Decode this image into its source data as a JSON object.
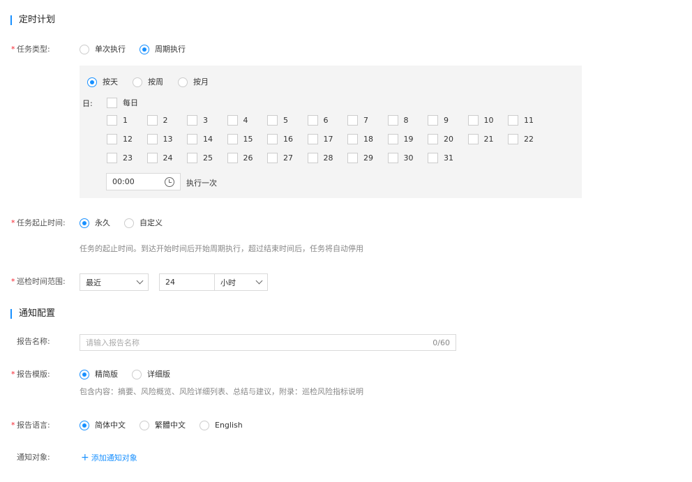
{
  "schedule": {
    "title": "定时计划",
    "task_type": {
      "label": "任务类型:",
      "options": [
        "单次执行",
        "周期执行"
      ],
      "selected": 1
    },
    "period": {
      "options": [
        "按天",
        "按周",
        "按月"
      ],
      "selected": 0,
      "day_label": "日:",
      "every_day": "每日",
      "days": [
        "1",
        "2",
        "3",
        "4",
        "5",
        "6",
        "7",
        "8",
        "9",
        "10",
        "11",
        "12",
        "13",
        "14",
        "15",
        "16",
        "17",
        "18",
        "19",
        "20",
        "21",
        "22",
        "23",
        "24",
        "25",
        "26",
        "27",
        "28",
        "29",
        "30",
        "31"
      ],
      "time": "00:00",
      "run_once": "执行一次"
    },
    "duration": {
      "label": "任务起止时间:",
      "options": [
        "永久",
        "自定义"
      ],
      "selected": 0,
      "hint": "任务的起止时间。到达开始时间后开始周期执行，超过结束时间后，任务将自动停用"
    },
    "range": {
      "label": "巡检时间范围:",
      "mode": "最近",
      "value": "24",
      "unit": "小时"
    }
  },
  "notify": {
    "title": "通知配置",
    "name": {
      "label": "报告名称:",
      "placeholder": "请输入报告名称",
      "count": "0/60"
    },
    "template": {
      "label": "报告模版:",
      "options": [
        "精简版",
        "详细版"
      ],
      "selected": 0,
      "hint": "包含内容：摘要、风险概览、风险详细列表、总结与建议，附录：巡检风险指标说明"
    },
    "language": {
      "label": "报告语言:",
      "options": [
        "简体中文",
        "繁體中文",
        "English"
      ],
      "selected": 0
    },
    "target": {
      "label": "通知对象:",
      "add": "添加通知对象"
    }
  },
  "colors": {
    "accent": "#1890ff",
    "required": "#f5222d",
    "panel": "#f4f4f4"
  }
}
